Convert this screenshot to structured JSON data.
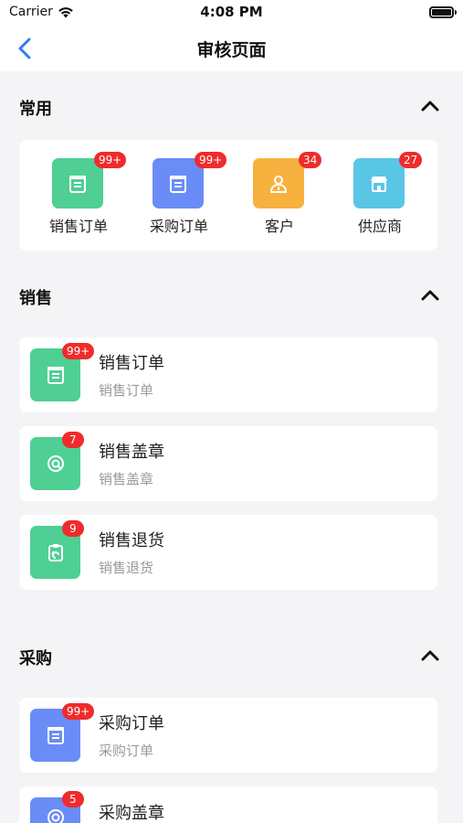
{
  "status_bar": {
    "carrier": "Carrier",
    "time": "4:08 PM"
  },
  "nav": {
    "title": "审核页面"
  },
  "colors": {
    "green": "#4fcf94",
    "blue": "#6a8cf6",
    "orange": "#f7b13f",
    "cyan": "#59c6e6",
    "badge": "#f02b2b"
  },
  "common": {
    "title": "常用",
    "items": [
      {
        "label": "销售订单",
        "badge": "99+",
        "icon": "order-icon",
        "color": "green"
      },
      {
        "label": "采购订单",
        "badge": "99+",
        "icon": "order-icon",
        "color": "blue"
      },
      {
        "label": "客户",
        "badge": "34",
        "icon": "customer-icon",
        "color": "orange"
      },
      {
        "label": "供应商",
        "badge": "27",
        "icon": "store-icon",
        "color": "cyan"
      }
    ]
  },
  "sales": {
    "title": "销售",
    "items": [
      {
        "title": "销售订单",
        "subtitle": "销售订单",
        "badge": "99+",
        "icon": "order-icon"
      },
      {
        "title": "销售盖章",
        "subtitle": "销售盖章",
        "badge": "7",
        "icon": "stamp-icon"
      },
      {
        "title": "销售退货",
        "subtitle": "销售退货",
        "badge": "9",
        "icon": "return-icon"
      }
    ]
  },
  "purchase": {
    "title": "采购",
    "items": [
      {
        "title": "采购订单",
        "subtitle": "采购订单",
        "badge": "99+",
        "icon": "order-icon"
      },
      {
        "title": "采购盖章",
        "badge": "5",
        "icon": "stamp-icon"
      }
    ]
  }
}
